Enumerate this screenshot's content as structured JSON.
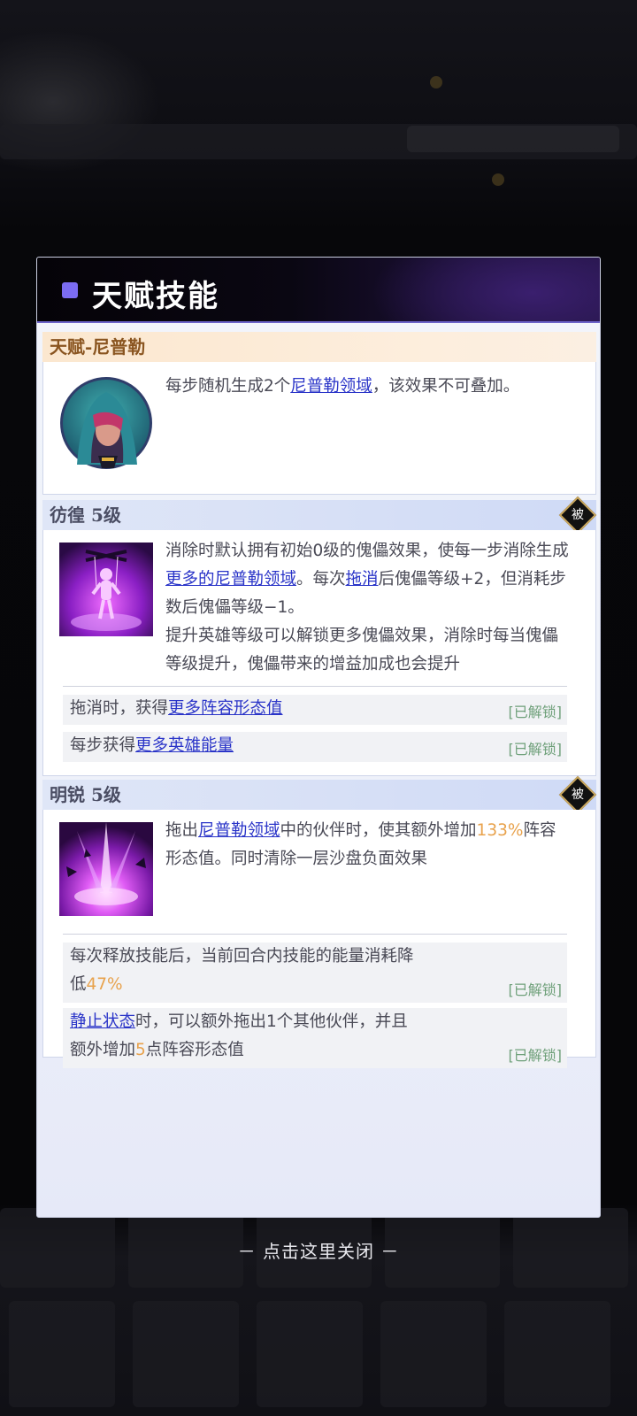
{
  "panel": {
    "title": "天赋技能",
    "accent_color": "#7b6cf2"
  },
  "talent": {
    "title": "天赋-尼普勒",
    "avatar_icon": "hooded-hero-portrait",
    "desc_prefix": "每步随机生成2个",
    "desc_link": "尼普勒领域",
    "desc_suffix": "，该效果不可叠加。"
  },
  "skill1": {
    "title": "彷徨 5级",
    "badge": "被",
    "icon": "puppet-skill-icon",
    "desc1_a": "消除时默认拥有初始0级的傀儡效果，使每一步消除生成",
    "desc1_link1": "更多的尼普勒领域",
    "desc1_b": "。每次",
    "desc1_link2": "拖消",
    "desc1_c": "后傀儡等级+2，但消耗步数后傀儡等级−1。",
    "desc2": "提升英雄等级可以解锁更多傀儡效果，消除时每当傀儡等级提升，傀儡带来的增益加成也会提升",
    "unlocks": [
      {
        "prefix": "拖消时，获得",
        "link": "更多阵容形态值",
        "tag": "[已解锁]"
      },
      {
        "prefix": "每步获得",
        "link": "更多英雄能量",
        "tag": "[已解锁]"
      }
    ]
  },
  "skill2": {
    "title": "明锐 5级",
    "badge": "被",
    "icon": "purple-burst-skill-icon",
    "desc_a": "拖出",
    "desc_link": "尼普勒领域",
    "desc_b": "中的伙伴时，使其额外增加",
    "desc_value": "133%",
    "desc_c": "阵容形态值。同时清除一层沙盘负面效果",
    "unlock1_line1": "每次释放技能后，当前回合内技能的能量消耗降",
    "unlock1_line2_prefix": "低",
    "unlock1_value": "47%",
    "unlock1_tag": "[已解锁]",
    "unlock2_link": "静止状态",
    "unlock2_line1_suffix": "时，可以额外拖出1个其他伙伴，并且",
    "unlock2_line2_prefix": "额外增加",
    "unlock2_value": "5",
    "unlock2_line2_suffix": "点阵容形态值",
    "unlock2_tag": "[已解锁]"
  },
  "close_text": "－ 点击这里关闭 －"
}
